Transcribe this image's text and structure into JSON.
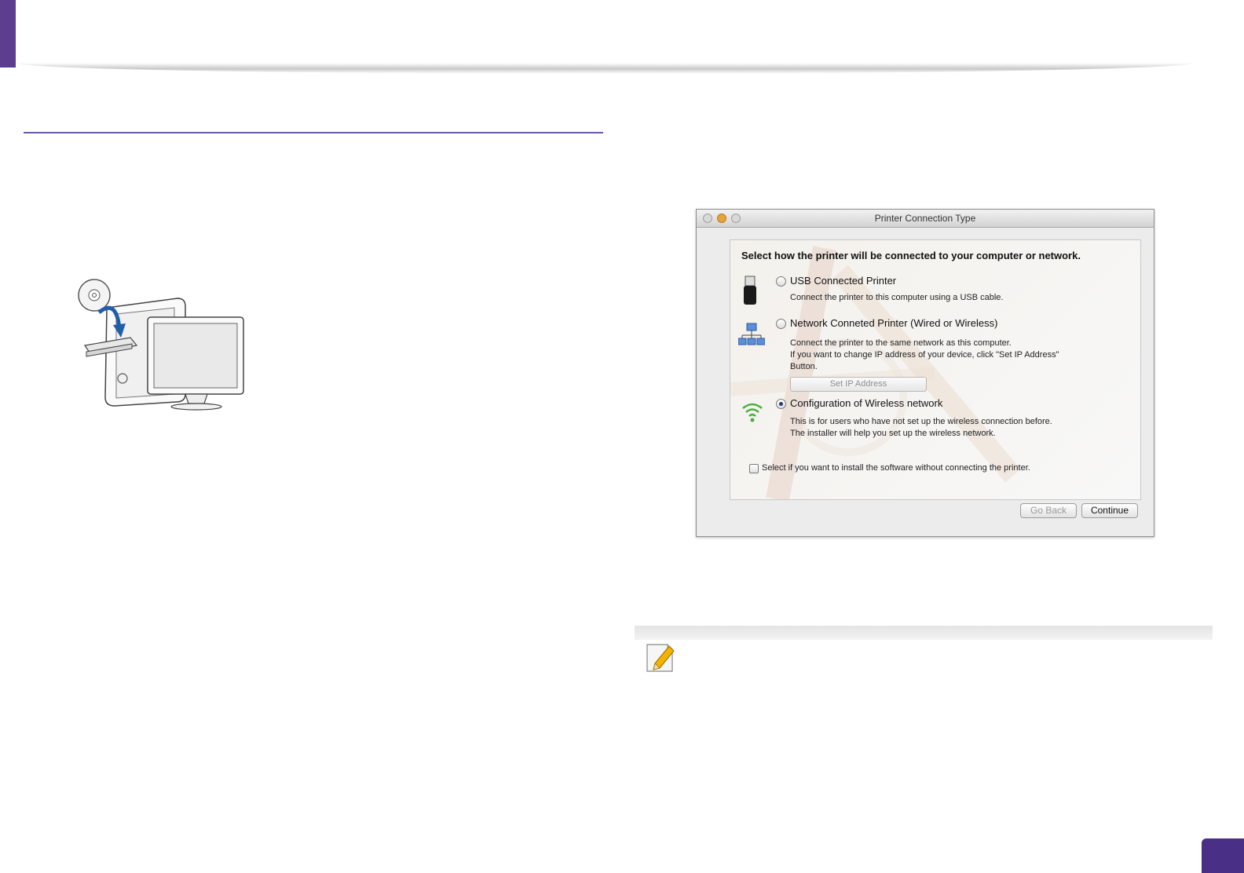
{
  "dialog": {
    "title": "Printer Connection Type",
    "heading": "Select how the printer will be connected to your computer or network.",
    "options": [
      {
        "label": "USB Connected Printer",
        "description": [
          "Connect the printer to this computer using a USB cable."
        ],
        "selected": false,
        "icon": "usb-icon"
      },
      {
        "label": "Network Conneted Printer (Wired or Wireless)",
        "description": [
          "Connect the printer to the same network as this computer.",
          "If you want to change IP address of your device, click \"Set IP Address\"",
          "Button."
        ],
        "selected": false,
        "icon": "network-icon"
      },
      {
        "label": "Configuration of Wireless network",
        "description": [
          "This is for users who have not set up the wireless connection before.",
          "The installer will help you set up the wireless network."
        ],
        "selected": true,
        "icon": "wifi-icon"
      }
    ],
    "set_ip_button": "Set IP Address",
    "checkbox_label": "Select if you want to install the software without connecting the printer.",
    "buttons": {
      "back": "Go Back",
      "continue": "Continue"
    }
  },
  "colors": {
    "accent": "#5c3d8f",
    "rule": "#6c5aa8",
    "page_tab": "#4a2f86"
  }
}
